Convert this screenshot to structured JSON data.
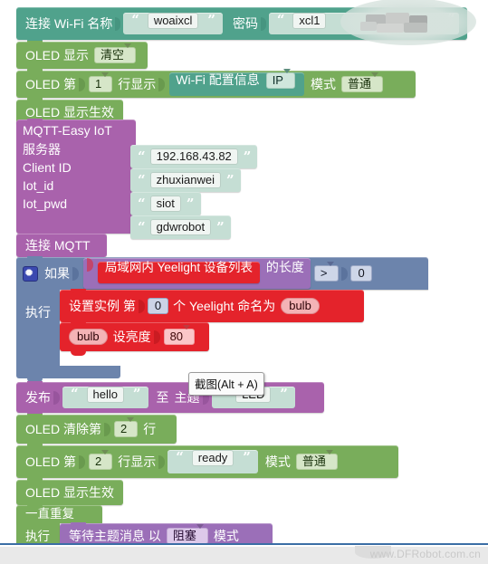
{
  "app": {
    "type": "blockly-visual-programming-workspace",
    "watermark": "www.DFRobot.com.cn"
  },
  "tooltip": {
    "text": "截图(Alt + A)"
  },
  "blocks": {
    "wifi_connect": {
      "label_connect": "连接 Wi-Fi 名称",
      "ssid_value": "woaixcl",
      "label_password": "密码",
      "password_value": "xcl1",
      "password_redacted": true
    },
    "oled_display_clear": {
      "label": "OLED 显示",
      "mode": "清空"
    },
    "oled_line_show_1": {
      "label_prefix": "OLED 第",
      "line": "1",
      "label_mid": "行显示",
      "source_block": "Wi-Fi 配置信息",
      "source_field": "IP",
      "label_mode": "模式",
      "mode": "普通"
    },
    "oled_refresh_1": {
      "label": "OLED 显示生效"
    },
    "mqtt": {
      "title": "MQTT-Easy IoT",
      "rows": [
        {
          "label": "服务器",
          "value": "192.168.43.82"
        },
        {
          "label": "Client ID",
          "value": "zhuxianwei"
        },
        {
          "label": "Iot_id",
          "value": "siot"
        },
        {
          "label": "Iot_pwd",
          "value": "gdwrobot"
        }
      ]
    },
    "mqtt_connect": {
      "label": "连接 MQTT"
    },
    "if_block": {
      "label_if": "如果",
      "label_do": "执行",
      "condition": {
        "list_block": "局域网内 Yeelight 设备列表",
        "length_label": "的长度",
        "operator": ">",
        "compare_value": "0"
      },
      "body": [
        {
          "type": "yeelight-set-instance",
          "label_a": "设置实例 第",
          "index": "0",
          "label_b": "个 Yeelight 命名为",
          "name": "bulb"
        },
        {
          "type": "yeelight-set-brightness",
          "target": "bulb",
          "label": "设亮度",
          "value": "80"
        }
      ]
    },
    "publish": {
      "label_publish": "发布",
      "message": "hello",
      "label_to": "至",
      "label_topic": "主题",
      "topic": "LED"
    },
    "oled_clear_line": {
      "label_prefix": "OLED 清除第",
      "line": "2",
      "label_suffix": "行"
    },
    "oled_line_show_2": {
      "label_prefix": "OLED 第",
      "line": "2",
      "label_mid": "行显示",
      "text": "ready",
      "label_mode": "模式",
      "mode": "普通"
    },
    "oled_refresh_2": {
      "label": "OLED 显示生效"
    },
    "repeat_forever": {
      "label": "一直重复",
      "label_do": "执行",
      "body": {
        "label_a": "等待主题消息 以",
        "mode": "阻塞",
        "label_b": "模式"
      }
    }
  },
  "colors": {
    "teal": "#50a28c",
    "green": "#79ad5b",
    "purple": "#a962ac",
    "blue": "#6c84ac",
    "red": "#e4232b",
    "light_purple": "#9b6fb8",
    "string_socket": "#c5ded4"
  }
}
